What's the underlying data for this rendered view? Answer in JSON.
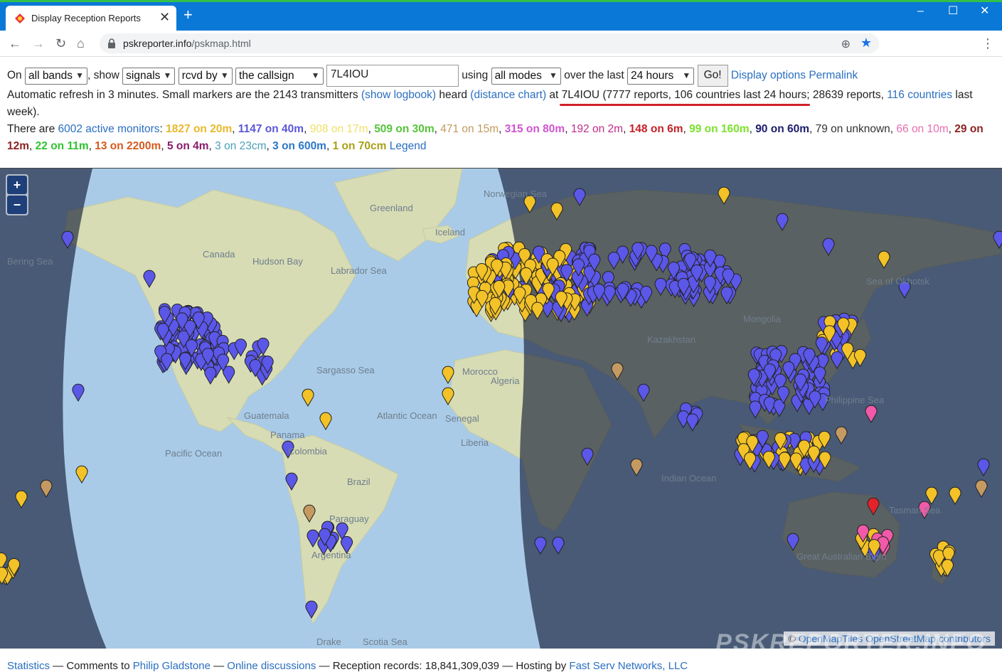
{
  "browser": {
    "tab_title": "Display Reception Reports",
    "new_tab_symbol": "+",
    "url_host": "pskreporter.info",
    "url_path": "/pskmap.html",
    "window_controls": [
      "–",
      "☐",
      "✕"
    ]
  },
  "controls": {
    "on_label": "On",
    "band": "all bands",
    "show_label": ", show",
    "show": "signals",
    "direction": "rcvd by",
    "target": "the callsign",
    "callsign": "7L4IOU",
    "using_label": "using",
    "mode": "all modes",
    "over_label": "over the last",
    "period": "24 hours",
    "go_label": "Go!",
    "display_options": "Display options",
    "permalink": "Permalink"
  },
  "status": {
    "part1": "Automatic refresh in 3 minutes. Small markers are the 2143 transmitters ",
    "show_logbook": "(show logbook)",
    "part2": " heard ",
    "distance_chart": "(distance chart)",
    "part3": " at 7L4IOU (7777 reports, 106 countries last 24 hours; 28639 reports, ",
    "countries_link": "116 countries",
    "part4": " last",
    "part5": "week)."
  },
  "monitors": {
    "intro": "There are ",
    "active_link": "6002 active monitors",
    "colon": ":",
    "bands": [
      {
        "text": "1827 on 20m",
        "color": "#e8b92c",
        "bold": true
      },
      {
        "text": "1147 on 40m",
        "color": "#5b57d8",
        "bold": true
      },
      {
        "text": "908 on 17m",
        "color": "#efe066",
        "bold": false
      },
      {
        "text": "509 on 30m",
        "color": "#56c43a",
        "bold": true
      },
      {
        "text": "471 on 15m",
        "color": "#c39a5e",
        "bold": false
      },
      {
        "text": "315 on 80m",
        "color": "#cf55cf",
        "bold": true
      },
      {
        "text": "192 on 2m",
        "color": "#c02d88",
        "bold": false
      },
      {
        "text": "148 on 6m",
        "color": "#c4222a",
        "bold": true
      },
      {
        "text": "99 on 160m",
        "color": "#7be22c",
        "bold": true
      },
      {
        "text": "90 on 60m",
        "color": "#1b1b6e",
        "bold": true
      },
      {
        "text": "79 on unknown",
        "color": "#333333",
        "bold": false
      },
      {
        "text": "66 on 10m",
        "color": "#e56fb0",
        "bold": false
      },
      {
        "text": "29 on 12m",
        "color": "#8a2322",
        "bold": true
      },
      {
        "text": "22 on 11m",
        "color": "#2fc42f",
        "bold": true
      },
      {
        "text": "13 on 2200m",
        "color": "#d75a1f",
        "bold": true
      },
      {
        "text": "5 on 4m",
        "color": "#8a1b6d",
        "bold": true
      },
      {
        "text": "3 on 23cm",
        "color": "#4aa0b8",
        "bold": false
      },
      {
        "text": "3 on 600m",
        "color": "#2a78c8",
        "bold": true
      },
      {
        "text": "1 on 70cm",
        "color": "#a8a013",
        "bold": true
      }
    ],
    "legend": "Legend"
  },
  "map": {
    "zoom_in": "+",
    "zoom_out": "−",
    "labels": [
      "Canada",
      "Hudson Bay",
      "Labrador Sea",
      "Greenland",
      "Norwegian Sea",
      "Iceland",
      "Sargasso Sea",
      "Atlantic Ocean",
      "Pacific Ocean",
      "Colombia",
      "Brazil",
      "Paraguay",
      "Argentina",
      "Drake",
      "Scotia Sea",
      "Morocco",
      "Algeria",
      "Senegal",
      "Liberia",
      "Kazakhstan",
      "Mongolia",
      "Sea of Okhotsk",
      "Philippine Sea",
      "Indian Ocean",
      "Tasman Sea",
      "Great Australian Bight",
      "Bering Sea",
      "Guatemala",
      "Panama"
    ],
    "attribution_prefix": "© ",
    "attribution_tiles": "OpenMapTiles",
    "attribution_osm": "OpenStreetMap contributors",
    "watermark": "PSKREPORTER.INFO"
  },
  "footer": {
    "statistics": "Statistics",
    "sep1": " — Comments to ",
    "author": "Philip Gladstone",
    "sep2": " — ",
    "online": "Online discussions",
    "sep3": " — Reception records: 18,841,309,039 — Hosting by ",
    "host": "Fast Serv Networks, LLC"
  },
  "colors": {
    "blue_marker": "#5b57e8",
    "yellow_marker": "#f2c227",
    "tan_marker": "#c49a62",
    "pink_marker": "#f05aa8",
    "red_marker": "#e2232a",
    "link": "#2a6fc0",
    "chrome": "#0a78d7"
  }
}
